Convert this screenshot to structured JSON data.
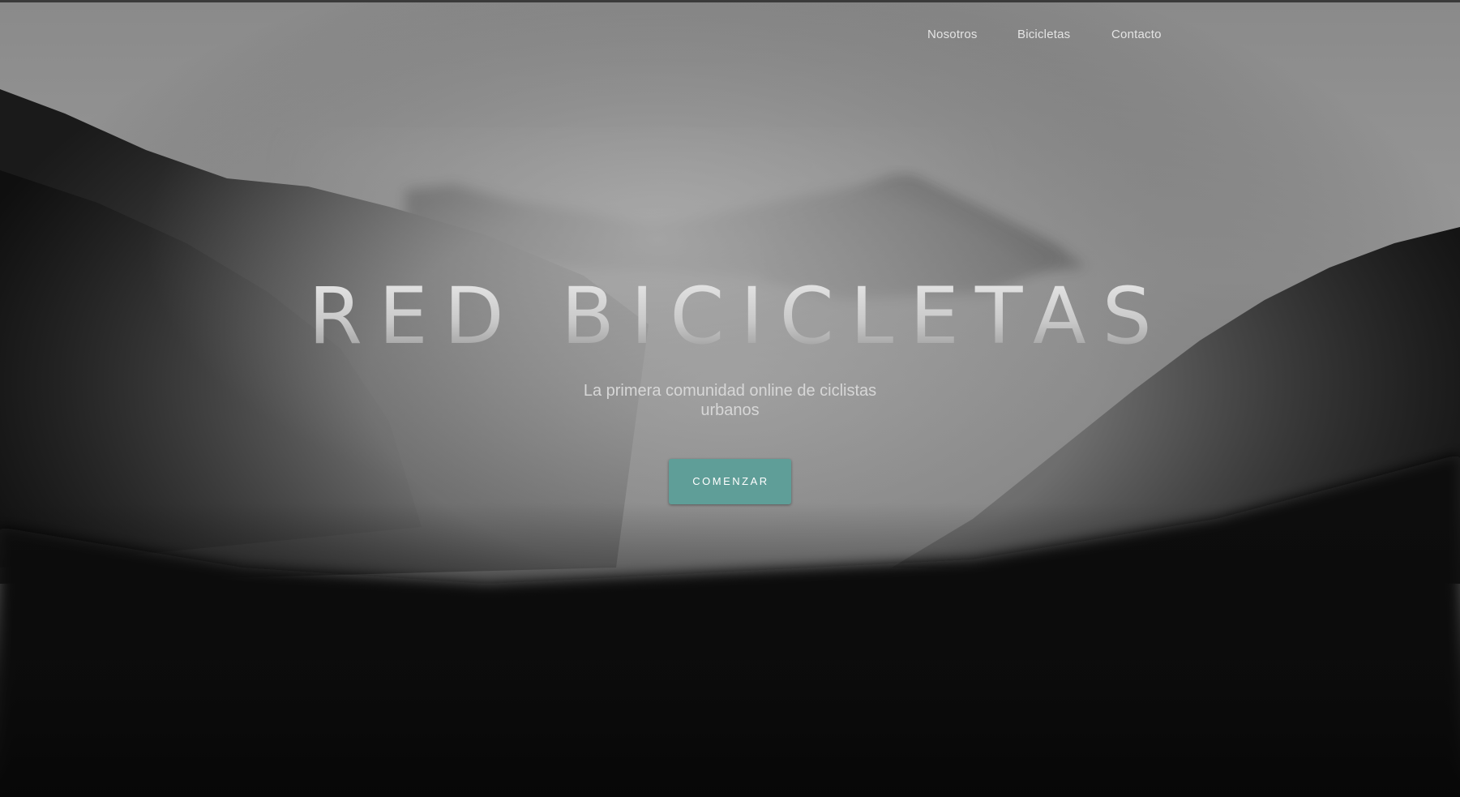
{
  "nav": {
    "items": [
      {
        "label": "Nosotros"
      },
      {
        "label": "Bicicletas"
      },
      {
        "label": "Contacto"
      }
    ]
  },
  "hero": {
    "title": "RED BICICLETAS",
    "subtitle": "La primera comunidad online de ciclistas urbanos",
    "cta_label": "COMENZAR",
    "background": "misty-forested-mountains-grayscale"
  },
  "colors": {
    "accent": "#5f9e98",
    "nav_text": "#e4e4e4",
    "title_text": "#d0d0d0"
  }
}
